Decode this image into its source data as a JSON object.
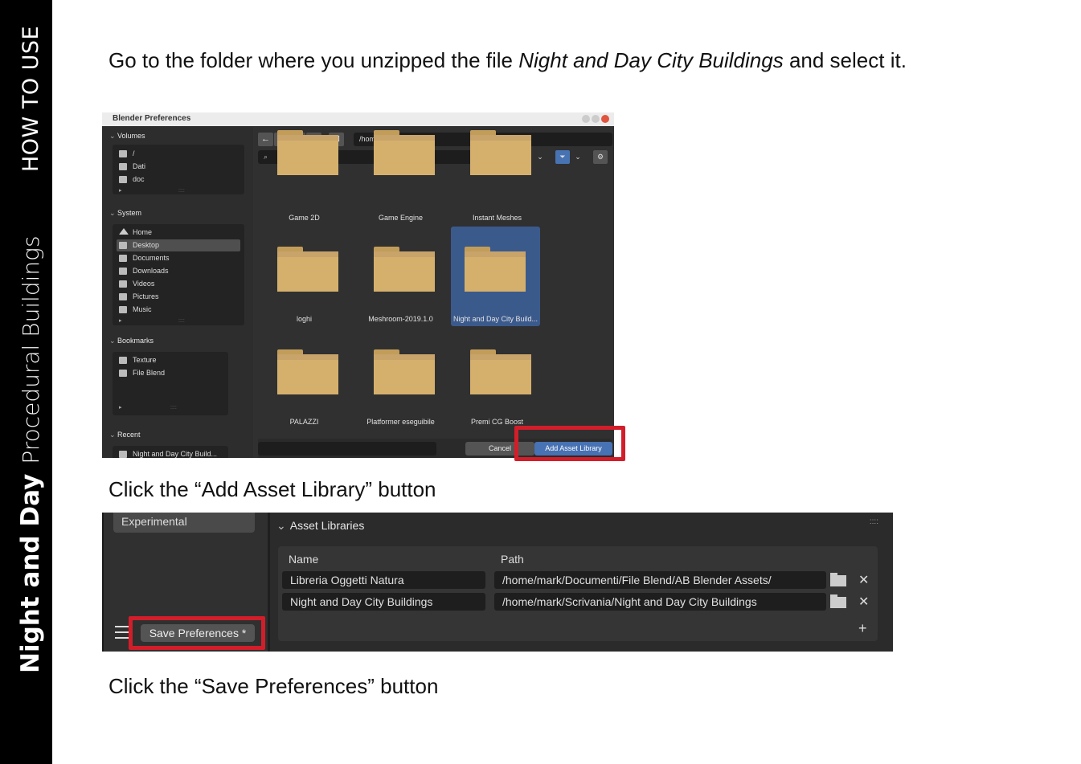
{
  "sidebar": {
    "section": "HOW TO USE",
    "brand_bold": "Night and Day",
    "brand_light": "Procedural Buildings"
  },
  "captions": {
    "intro_before": "Go to the folder where you unzipped the file ",
    "intro_italic": "Night and Day City Buildings",
    "intro_after": " and select it.",
    "step_add": "Click the “Add Asset Library” button",
    "step_save": "Click the “Save Preferences” button"
  },
  "file_browser": {
    "window_title": "Blender Preferences",
    "panels": {
      "volumes": {
        "title": "Volumes",
        "items": [
          "/",
          "Dati",
          "doc"
        ]
      },
      "system": {
        "title": "System",
        "items": [
          "Home",
          "Desktop",
          "Documents",
          "Downloads",
          "Videos",
          "Pictures",
          "Music"
        ],
        "selected": "Desktop"
      },
      "bookmarks": {
        "title": "Bookmarks",
        "items": [
          "Texture",
          "File Blend"
        ]
      },
      "recent": {
        "title": "Recent",
        "items": [
          "Night and Day City Build..."
        ]
      }
    },
    "path": "/home/mark/Scrivania/",
    "folders": [
      "Game 2D",
      "Game Engine",
      "Instant Meshes",
      "loghi",
      "Meshroom-2019.1.0",
      "Night and Day City Build...",
      "PALAZZI",
      "Platformer eseguibile",
      "Premi CG Boost"
    ],
    "selected_folder": "Night and Day City Build...",
    "cancel_label": "Cancel",
    "add_label": "Add Asset Library",
    "highlight_color": "#d21e2a",
    "accent_color": "#4772b3"
  },
  "preferences": {
    "sidebar_tab": "Experimental",
    "section_title": "Asset Libraries",
    "col_name": "Name",
    "col_path": "Path",
    "libraries": [
      {
        "name": "Libreria Oggetti Natura",
        "path": "/home/mark/Documenti/File Blend/AB Blender Assets/"
      },
      {
        "name": "Night and Day City Buildings",
        "path": "/home/mark/Scrivania/Night and Day City Buildings"
      }
    ],
    "save_label": "Save Preferences *"
  }
}
